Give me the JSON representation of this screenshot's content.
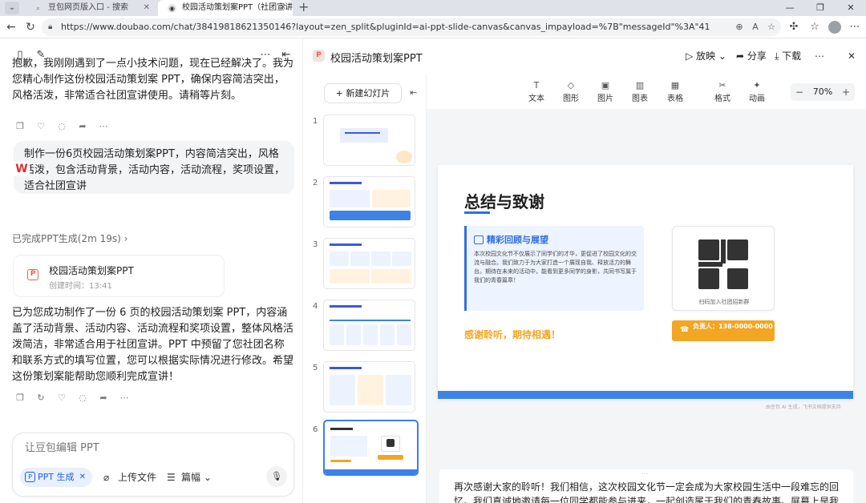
{
  "browser": {
    "tabs": [
      {
        "title": "豆包网页版入口 - 搜索",
        "active": false
      },
      {
        "title": "校园活动策划案PPT（社团宣讲）",
        "active": true
      }
    ],
    "url": "https://www.doubao.com/chat/38419818621350146?layout=zen_split&pluginId=ai-ppt-slide-canvas&canvas_impayload=%7B\"messageId\"%3A\"41739798540532226\"%2C\"conversationId\"%3..."
  },
  "chat": {
    "top_message": "抱歉，我刚刚遇到了一点小技术问题，现在已经解决了。我为您精心制作这份校园活动策划案 PPT，确保内容简洁突出，风格活泼，非常适合社团宣讲使用。请稍等片刻。",
    "user_message": "制作一份6页校园活动策划案PPT，内容简洁突出，风格活泼，包含活动背景，活动内容，活动流程，奖项设置，适合社团宣讲",
    "status_text": "已完成PPT生成(2m 19s)",
    "ppt_card": {
      "title": "校园活动策划案PPT",
      "time": "创建时间：13:41"
    },
    "bottom_message": "已为您成功制作了一份 6 页的校园活动策划案 PPT，内容涵盖了活动背景、活动内容、活动流程和奖项设置，整体风格活泼简洁，非常适合用于社团宣讲。PPT 中预留了您社团名称和联系方式的填写位置，您可以根据实际情况进行修改。希望这份策划案能帮助您顺利完成宣讲！",
    "input": {
      "placeholder": "让豆包编辑 PPT",
      "chip_label": "PPT 生成",
      "upload_label": "上传文件",
      "length_label": "篇幅"
    }
  },
  "ppt": {
    "title": "校园活动策划案PPT",
    "present_label": "放映",
    "share_label": "分享",
    "download_label": "下载",
    "new_slide_label": "+ 新建幻灯片",
    "slide_numbers": [
      "1",
      "2",
      "3",
      "4",
      "5",
      "6"
    ],
    "active_slide": 6,
    "toolbar": [
      "文本",
      "图形",
      "图片",
      "图表",
      "表格",
      "格式",
      "动画"
    ],
    "zoom": "70%",
    "slide": {
      "title": "总结与致谢",
      "review_title": "精彩回顾与展望",
      "review_body": "本次校园文化节不仅展示了同学们的才华，更促进了校园文化的交流与融合。我们致力于为大家打造一个展现自我、释放活力的舞台。期待在未来的活动中，能看到更多同学的身影，共同书写属于我们的青春篇章！",
      "thanks": "感谢聆听，期待相遇！",
      "qr_caption": "扫码加入社团招新群",
      "contact": "负责人：138-0000-0000"
    },
    "watermark": "由豆包 AI 生成，飞书文档提供支持",
    "notes": "再次感谢大家的聆听！我们相信，这次校园文化节一定会成为大家校园生活中一段难忘的回忆。我们真诚地邀请每一位同学都能参与进来，一起创造属于我们的青春故事。屏幕上是我们社团的招新"
  },
  "colors": {
    "accent_blue": "#2f6fe0",
    "accent_orange": "#f2a623",
    "footer_blue": "#3d82e6",
    "ppt_red": "#e8614b"
  }
}
